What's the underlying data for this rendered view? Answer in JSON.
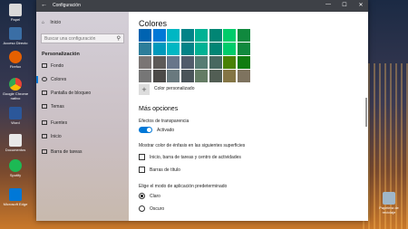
{
  "desktop": {
    "icons": [
      {
        "label": "Papel",
        "color": "#d9d9d9"
      },
      {
        "label": "Acceso Directo",
        "color": "#3a6ea5"
      },
      {
        "label": "Firefox",
        "color": "#e66000"
      },
      {
        "label": "Google Chrome nativo",
        "color": "#34a853"
      },
      {
        "label": "Word",
        "color": "#2b579a"
      },
      {
        "label": "Documentos",
        "color": "#e8e8e8"
      },
      {
        "label": "Spotify",
        "color": "#1db954"
      },
      {
        "label": "Microsoft Edge",
        "color": "#0078d7"
      }
    ],
    "trash_label": "Papelera de reciclaje"
  },
  "window": {
    "title": "Configuración",
    "back_icon": "back-arrow-icon",
    "controls": [
      "—",
      "☐",
      "✕"
    ]
  },
  "sidebar": {
    "home": "Inicio",
    "search_placeholder": "Buscar una configuración",
    "section": "Personalización",
    "items": [
      {
        "label": "Fondo",
        "icon": "image-icon"
      },
      {
        "label": "Colores",
        "icon": "palette-icon",
        "active": true
      },
      {
        "label": "Pantalla de bloqueo",
        "icon": "lock-screen-icon"
      },
      {
        "label": "Temas",
        "icon": "brush-icon"
      },
      {
        "label": "Fuentes",
        "icon": "font-icon"
      },
      {
        "label": "Inicio",
        "icon": "start-icon"
      },
      {
        "label": "Barra de tareas",
        "icon": "taskbar-icon"
      }
    ]
  },
  "content": {
    "heading": "Colores",
    "swatch_rows": [
      [
        "#0063b1",
        "#0078d7",
        "#00b7c3",
        "#038387",
        "#00b294",
        "#018574",
        "#00cc6a",
        "#10893e"
      ],
      [
        "#2d7d9a",
        "#0099bc",
        "#00b7c3",
        "#038387",
        "#00b294",
        "#018574",
        "#00cc6a",
        "#10893e"
      ],
      [
        "#7a7574",
        "#5d5a58",
        "#68768a",
        "#515c6b",
        "#567c73",
        "#486860",
        "#498205",
        "#107c10"
      ],
      [
        "#767676",
        "#4c4a48",
        "#69797e",
        "#4a5459",
        "#647c64",
        "#525e54",
        "#847545",
        "#7e735f"
      ]
    ],
    "custom_color_label": "Color personalizado",
    "more_options": "Más opciones",
    "transparency_label": "Efectos de transparencia",
    "transparency_state": "Activado",
    "accent_surfaces_label": "Mostrar color de énfasis en las siguientes superficies",
    "checkbox_start": "Inicio, barra de tareas y centro de actividades",
    "checkbox_titlebars": "Barras de título",
    "app_mode_label": "Elige el modo de aplicación predeterminado",
    "mode_light": "Claro",
    "mode_dark": "Oscuro"
  }
}
